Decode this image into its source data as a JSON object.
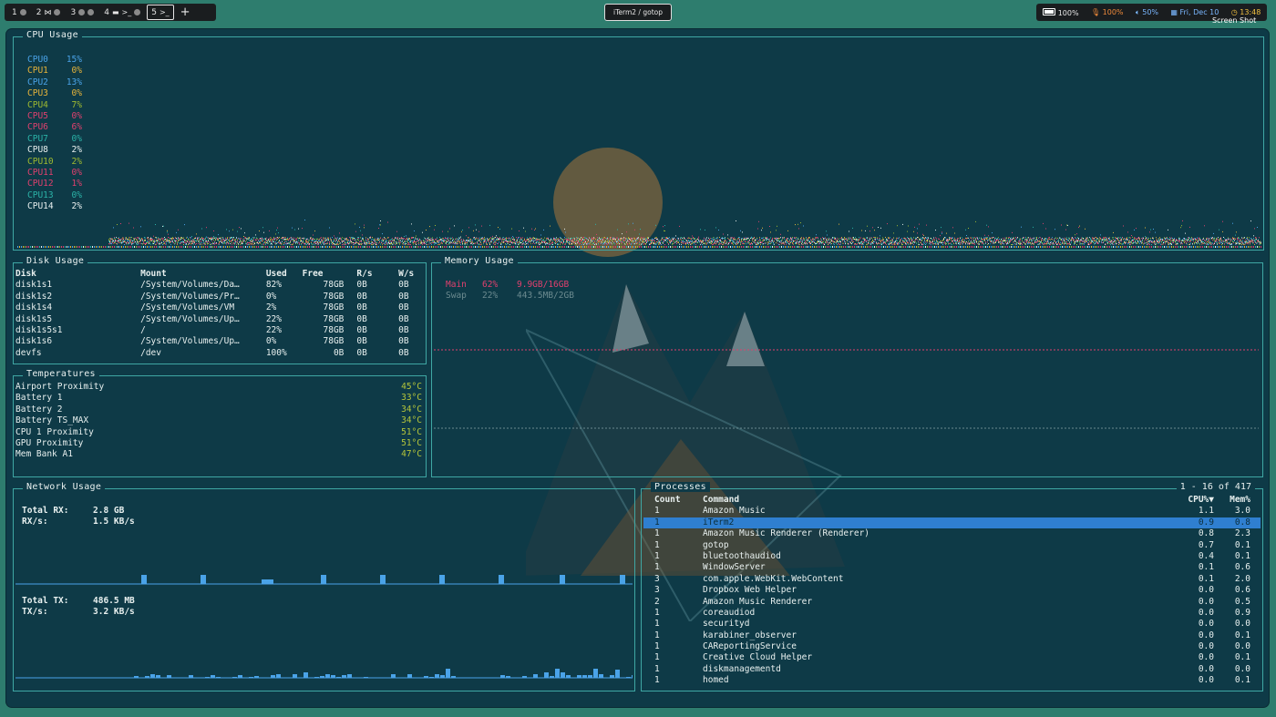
{
  "workspaces": [
    {
      "num": "1",
      "icons": [
        "app-icon"
      ]
    },
    {
      "num": "2",
      "icons": [
        "music-icon",
        "app-icon"
      ]
    },
    {
      "num": "3",
      "icons": [
        "app-icon",
        "app-icon"
      ]
    },
    {
      "num": "4",
      "icons": [
        "window-icon",
        "terminal-icon",
        "app-icon"
      ]
    },
    {
      "num": "5",
      "icons": [
        "terminal-icon"
      ],
      "active": true
    }
  ],
  "add_workspace": "+",
  "window_title": "iTerm2 / gotop",
  "status": {
    "battery": "100%",
    "mic": "100%",
    "volume": "50%",
    "date": "Fri, Dec 10",
    "time": "13:48",
    "screenshot_label": "Screen Shot"
  },
  "cpu": {
    "title": "CPU Usage",
    "cores": [
      {
        "name": "CPU0",
        "value": "15%",
        "color": "#4aa3e8"
      },
      {
        "name": "CPU1",
        "value": "0%",
        "color": "#e8b43a"
      },
      {
        "name": "CPU2",
        "value": "13%",
        "color": "#4aa3e8"
      },
      {
        "name": "CPU3",
        "value": "0%",
        "color": "#e8b43a"
      },
      {
        "name": "CPU4",
        "value": "7%",
        "color": "#9fba30"
      },
      {
        "name": "CPU5",
        "value": "0%",
        "color": "#e0406e"
      },
      {
        "name": "CPU6",
        "value": "6%",
        "color": "#e0406e"
      },
      {
        "name": "CPU7",
        "value": "0%",
        "color": "#2bb3a8"
      },
      {
        "name": "CPU8",
        "value": "2%",
        "color": "#e8f0ef"
      },
      {
        "name": "",
        "value": "",
        "color": "#e8f0ef"
      },
      {
        "name": "CPU10",
        "value": "2%",
        "color": "#9fba30"
      },
      {
        "name": "CPU11",
        "value": "0%",
        "color": "#e0406e"
      },
      {
        "name": "CPU12",
        "value": "1%",
        "color": "#e0406e"
      },
      {
        "name": "CPU13",
        "value": "0%",
        "color": "#2bb3a8"
      },
      {
        "name": "CPU14",
        "value": "2%",
        "color": "#e8f0ef"
      }
    ]
  },
  "disk": {
    "title": "Disk Usage",
    "headers": [
      "Disk",
      "Mount",
      "Used",
      "Free",
      "R/s",
      "W/s"
    ],
    "rows": [
      [
        "disk1s1",
        "/System/Volumes/Da…",
        "82%",
        "78GB",
        "0B",
        "0B"
      ],
      [
        "disk1s2",
        "/System/Volumes/Pr…",
        "0%",
        "78GB",
        "0B",
        "0B"
      ],
      [
        "disk1s4",
        "/System/Volumes/VM",
        "2%",
        "78GB",
        "0B",
        "0B"
      ],
      [
        "disk1s5",
        "/System/Volumes/Up…",
        "22%",
        "78GB",
        "0B",
        "0B"
      ],
      [
        "disk1s5s1",
        "/",
        "22%",
        "78GB",
        "0B",
        "0B"
      ],
      [
        "disk1s6",
        "/System/Volumes/Up…",
        "0%",
        "78GB",
        "0B",
        "0B"
      ],
      [
        "devfs",
        "/dev",
        "100%",
        "0B",
        "0B",
        "0B"
      ]
    ]
  },
  "temperatures": {
    "title": "Temperatures",
    "rows": [
      {
        "name": "Airport Proximity",
        "value": "45°C"
      },
      {
        "name": "Battery 1",
        "value": "33°C"
      },
      {
        "name": "Battery 2",
        "value": "34°C"
      },
      {
        "name": "Battery TS_MAX",
        "value": "34°C"
      },
      {
        "name": "CPU 1 Proximity",
        "value": "51°C"
      },
      {
        "name": "GPU Proximity",
        "value": "51°C"
      },
      {
        "name": "Mem Bank A1",
        "value": "47°C"
      }
    ]
  },
  "memory": {
    "title": "Memory Usage",
    "main": {
      "label": "Main",
      "percent": "62%",
      "value": "9.9GB/16GB",
      "color": "#e0406e"
    },
    "swap": {
      "label": "Swap",
      "percent": "22%",
      "value": "443.5MB/2GB",
      "color": "#6b8a8f"
    }
  },
  "network": {
    "title": "Network Usage",
    "total_rx_label": "Total RX:",
    "total_rx": "2.8 GB",
    "rx_rate_label": "RX/s:",
    "rx_rate": "1.5 KB/s",
    "total_tx_label": "Total TX:",
    "total_tx": "486.5 MB",
    "tx_rate_label": "TX/s:",
    "tx_rate": "3.2 KB/s"
  },
  "processes": {
    "title": "Processes",
    "count_label": "1 - 16 of 417",
    "headers": [
      "Count",
      "Command",
      "CPU%▼",
      "Mem%"
    ],
    "selected_index": 1,
    "rows": [
      [
        "1",
        "Amazon Music",
        "1.1",
        "3.0"
      ],
      [
        "1",
        "iTerm2",
        "0.9",
        "0.8"
      ],
      [
        "1",
        "Amazon Music Renderer (Renderer)",
        "0.8",
        "2.3"
      ],
      [
        "1",
        "gotop",
        "0.7",
        "0.1"
      ],
      [
        "1",
        "bluetoothaudiod",
        "0.4",
        "0.1"
      ],
      [
        "1",
        "WindowServer",
        "0.1",
        "0.6"
      ],
      [
        "3",
        "com.apple.WebKit.WebContent",
        "0.1",
        "2.0"
      ],
      [
        "3",
        "Dropbox Web Helper",
        "0.0",
        "0.6"
      ],
      [
        "2",
        "Amazon Music Renderer",
        "0.0",
        "0.5"
      ],
      [
        "1",
        "coreaudiod",
        "0.0",
        "0.9"
      ],
      [
        "1",
        "securityd",
        "0.0",
        "0.0"
      ],
      [
        "1",
        "karabiner_observer",
        "0.0",
        "0.1"
      ],
      [
        "1",
        "CAReportingService",
        "0.0",
        "0.0"
      ],
      [
        "1",
        "Creative Cloud Helper",
        "0.0",
        "0.1"
      ],
      [
        "1",
        "diskmanagementd",
        "0.0",
        "0.0"
      ],
      [
        "1",
        "homed",
        "0.0",
        "0.1"
      ]
    ]
  }
}
